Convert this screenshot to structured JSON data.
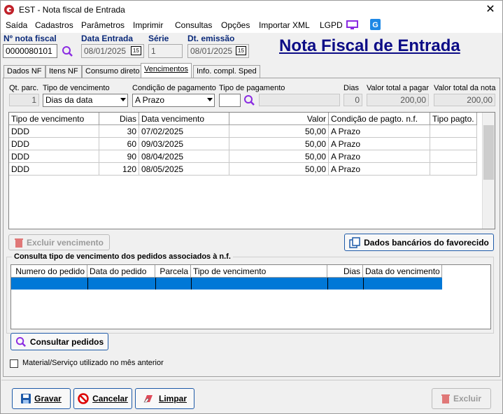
{
  "window": {
    "title": "EST - Nota fiscal de Entrada",
    "close": "✕"
  },
  "menu": [
    "Saída",
    "Cadastros",
    "Parâmetros",
    "Imprimir",
    "Consultas",
    "Opções",
    "Importar XML",
    "LGPD"
  ],
  "header": {
    "nota_label": "Nº nota fiscal",
    "nota_value": "0000080101",
    "data_entrada_label": "Data Entrada",
    "data_entrada_value": "08/01/2025",
    "serie_label": "Série",
    "serie_value": "1",
    "dt_emissao_label": "Dt. emissão",
    "dt_emissao_value": "08/01/2025",
    "cal_text": "15",
    "big_title": "Nota Fiscal de Entrada"
  },
  "tabs": [
    "Dados NF",
    "Itens NF",
    "Consumo direto",
    "Vencimentos",
    "Info. compl. Sped"
  ],
  "vencimentos": {
    "qt_parc_label": "Qt. parc.",
    "qt_parc_value": "1",
    "tipo_venc_label": "Tipo de vencimento",
    "tipo_venc_value": "Dias da data",
    "cond_pag_label": "Condição de pagamento",
    "cond_pag_value": "A Prazo",
    "tipo_pag_label": "Tipo de pagamento",
    "tipo_pag_value": "",
    "dias_label": "Dias",
    "dias_value": "0",
    "valor_pagar_label": "Valor total a pagar",
    "valor_pagar_value": "200,00",
    "valor_nota_label": "Valor total da nota",
    "valor_nota_value": "200,00"
  },
  "grid": {
    "columns": [
      "Tipo de vencimento",
      "Dias",
      "Data vencimento",
      "Valor",
      "Condição de pagto. n.f.",
      "Tipo pagto."
    ],
    "rows": [
      [
        "DDD",
        "30",
        "07/02/2025",
        "50,00",
        "A Prazo",
        ""
      ],
      [
        "DDD",
        "60",
        "09/03/2025",
        "50,00",
        "A Prazo",
        ""
      ],
      [
        "DDD",
        "90",
        "08/04/2025",
        "50,00",
        "A Prazo",
        ""
      ],
      [
        "DDD",
        "120",
        "08/05/2025",
        "50,00",
        "A Prazo",
        ""
      ]
    ]
  },
  "buttons": {
    "excluir_venc": "Excluir vencimento",
    "dados_bancarios": "Dados bancários do favorecido",
    "consultar_pedidos": "Consultar pedidos",
    "gravar": "Gravar",
    "cancelar": "Cancelar",
    "limpar": "Limpar",
    "excluir": "Excluir"
  },
  "consulta": {
    "title": "Consulta tipo de vencimento dos pedidos associados à n.f.",
    "columns": [
      "Numero do pedido",
      "Data do pedido",
      "Parcela",
      "Tipo de vencimento",
      "Dias",
      "Data do vencimento"
    ]
  },
  "checkbox_label": "Material/Serviço utilizado no mês anterior",
  "colors": {
    "accent": "#0078d7",
    "title": "#0c0c86",
    "label": "#0b2a7a"
  }
}
